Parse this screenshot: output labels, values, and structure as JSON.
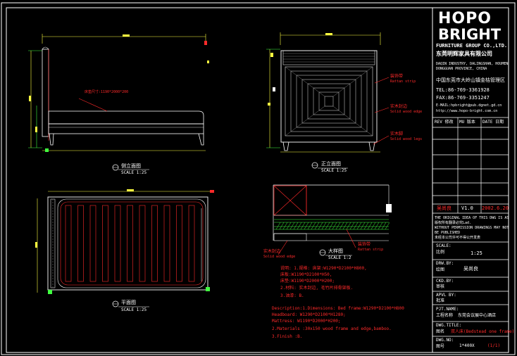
{
  "brand": {
    "logo_top": "HOPO",
    "logo_bottom": "BRIGHT",
    "company_en": "FURNITURE GROUP CO.,LTD.",
    "company_cn": "东莞明辉家具有限公司",
    "address_en": [
      "DAQIN INDUSTRY, DALINGSHAN, HOUMEN",
      "DONGGUAN PROVINCE, CHINA"
    ],
    "address_cn": "中国东莞市大岭山镇金桔管理区",
    "tel": "TEL:86-769-3361928",
    "fax": "FAX:86-769-3351247",
    "email": "E-MAIL:hpbright@pub.dgnet.gd.cn",
    "web": "http://www.hopo-bright.com.cn"
  },
  "revision": {
    "header": [
      "REV 修改",
      "MU 版本",
      "DATE 日期"
    ],
    "designer": "吴尚良",
    "version": "V1.0",
    "date": "2002.6.20"
  },
  "notice": [
    "THE ORIGINAL IDEA OF THIS DWG IS AS",
    "版权所有翻录必究Lad.",
    "WITHOUT PERMISSION DRAWINGS MAY NOT",
    "BE PUBLISHED",
    "未经本公司许可不得公开发表"
  ],
  "title_block": [
    {
      "label_en": "SCALE:",
      "label_cn": "比例",
      "value": "1:25"
    },
    {
      "label_en": "DRW.BY:",
      "label_cn": "绘图",
      "value": "吴尚良"
    },
    {
      "label_en": "CKD.BY:",
      "label_cn": "审核",
      "value": ""
    },
    {
      "label_en": "APVL BY:",
      "label_cn": "批准",
      "value": ""
    },
    {
      "label_en": "PJT.NAME:",
      "label_cn": "工程名称",
      "value": "东莞会议展中心酒店"
    },
    {
      "label_en": "DWG.TITLE:",
      "label_cn": "图名",
      "value": "双人床(Bedstead one frame)"
    },
    {
      "label_en": "DWG.NO:",
      "label_cn": "图号",
      "value": "1*400X",
      "extra": "(1/1)"
    }
  ],
  "views": {
    "side": {
      "title": "侧立面图",
      "scale": "SCALE 1:25"
    },
    "front": {
      "title": "正立面图",
      "scale": "SCALE 1:25"
    },
    "plan": {
      "title": "平面图",
      "scale": "SCALE 1:25"
    },
    "detail": {
      "title": "大样图",
      "scale": "SCALE 1:2"
    }
  },
  "callouts": {
    "side_mattress": "床垫尺寸:1190*2000*200",
    "front_1_cn": "装饰带",
    "front_1_en": "Rattan strip",
    "front_2_cn": "实木封边",
    "front_2_en": "Solid wood edge",
    "front_3_cn": "实木脚",
    "front_3_en": "Solid wood legs",
    "detail_left_cn": "实木封边",
    "detail_left_en": "Solid wood edge",
    "detail_right_cn": "装饰带",
    "detail_right_en": "Rattan strip"
  },
  "notes_cn": [
    "说明:  1.规格: 床架:W1290*D2100*H800,",
    "                 床板:W1190*D2100*H50,",
    "                 床垫:W1190*D2000*H200;",
    "       2.材料: 实木封边, 毛竹片排骨架板.",
    "       3.油漆: B."
  ],
  "notes_en": [
    "Description:1.Dimensions: Bed frame:W1290*D2100*H800",
    "              Headboard: W1290*D2100*H1280;",
    "              Mattress: W1190*D2000*H200;",
    "            2.Materials :30x150 wood frame and edge,bamboo.",
    "            3.Finish :B."
  ]
}
